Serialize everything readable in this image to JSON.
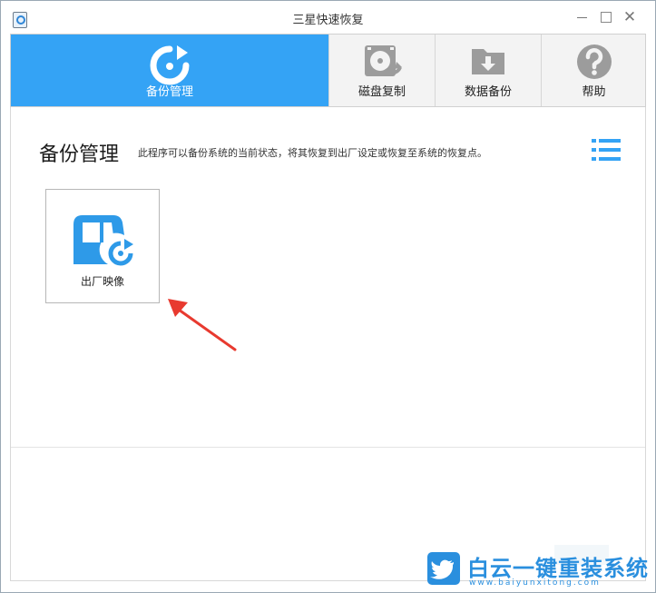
{
  "window": {
    "title": "三星快速恢复",
    "controls": [
      "minimize",
      "maximize",
      "close"
    ],
    "close_glyph": "✕"
  },
  "nav": {
    "tabs": [
      {
        "label": "备份管理",
        "icon": "backup-restore-icon",
        "active": true
      },
      {
        "label": "磁盘复制",
        "icon": "disk-copy-icon",
        "active": false
      },
      {
        "label": "数据备份",
        "icon": "folder-download-icon",
        "active": false
      },
      {
        "label": "帮助",
        "icon": "help-icon",
        "active": false
      }
    ]
  },
  "main": {
    "title": "备份管理",
    "description": "此程序可以备份系统的当前状态，将其恢复到出厂设定或恢复至系统的恢复点。",
    "view_toggle_icon": "list-view-icon",
    "items": [
      {
        "label": "出厂映像",
        "icon": "factory-image-icon"
      }
    ]
  },
  "watermark": {
    "title": "白云一键重装系统",
    "url": "www.baiyunxitong.com",
    "icon": "twitter-bird-icon"
  },
  "colors": {
    "accent": "#34a3f5",
    "icon_gray": "#9c9c9c",
    "card_icon": "#2e9ae8",
    "annotation_arrow": "#e83a2f"
  }
}
